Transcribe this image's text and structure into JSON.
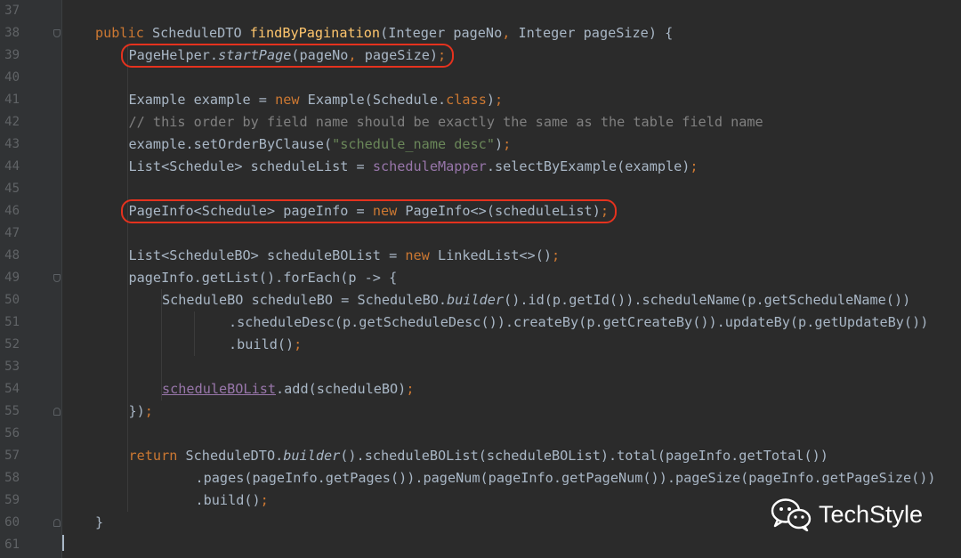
{
  "editor": {
    "lines": [
      {
        "no": "37",
        "tokens": []
      },
      {
        "no": "38",
        "fold": "start",
        "tokens": [
          {
            "t": "public ",
            "c": "k"
          },
          {
            "t": "ScheduleDTO "
          },
          {
            "t": "findByPagination",
            "c": "f"
          },
          {
            "t": "(Integer pageNo"
          },
          {
            "t": ", ",
            "c": "k"
          },
          {
            "t": "Integer pageSize) {"
          }
        ]
      },
      {
        "no": "39",
        "indent": 1,
        "tokens": [
          {
            "t": "PageHelper."
          },
          {
            "t": "startPage",
            "c": "i"
          },
          {
            "t": "(pageNo"
          },
          {
            "t": ", ",
            "c": "k"
          },
          {
            "t": "pageSize)"
          },
          {
            "t": ";",
            "c": "k"
          }
        ]
      },
      {
        "no": "40",
        "tokens": []
      },
      {
        "no": "41",
        "indent": 1,
        "tokens": [
          {
            "t": "Example example = "
          },
          {
            "t": "new ",
            "c": "k"
          },
          {
            "t": "Example(Schedule."
          },
          {
            "t": "class",
            "c": "k"
          },
          {
            "t": ")"
          },
          {
            "t": ";",
            "c": "k"
          }
        ]
      },
      {
        "no": "42",
        "indent": 1,
        "tokens": [
          {
            "t": "// this order by field name should be exactly the same as the table field name",
            "c": "c"
          }
        ]
      },
      {
        "no": "43",
        "indent": 1,
        "tokens": [
          {
            "t": "example.setOrderByClause("
          },
          {
            "t": "\"schedule_name desc\"",
            "c": "s"
          },
          {
            "t": ")"
          },
          {
            "t": ";",
            "c": "k"
          }
        ]
      },
      {
        "no": "44",
        "indent": 1,
        "tokens": [
          {
            "t": "List<Schedule> scheduleList = "
          },
          {
            "t": "scheduleMapper",
            "c": "p"
          },
          {
            "t": ".selectByExample(example)"
          },
          {
            "t": ";",
            "c": "k"
          }
        ]
      },
      {
        "no": "45",
        "tokens": []
      },
      {
        "no": "46",
        "indent": 1,
        "tokens": [
          {
            "t": "PageInfo<Schedule> pageInfo = "
          },
          {
            "t": "new ",
            "c": "k"
          },
          {
            "t": "PageInfo<>(scheduleList)"
          },
          {
            "t": ";",
            "c": "k"
          }
        ]
      },
      {
        "no": "47",
        "tokens": []
      },
      {
        "no": "48",
        "indent": 1,
        "tokens": [
          {
            "t": "List<ScheduleBO> scheduleBOList = "
          },
          {
            "t": "new ",
            "c": "k"
          },
          {
            "t": "LinkedList<>()"
          },
          {
            "t": ";",
            "c": "k"
          }
        ]
      },
      {
        "no": "49",
        "indent": 1,
        "fold": "start",
        "tokens": [
          {
            "t": "pageInfo.getList().forEach(p -> {"
          }
        ]
      },
      {
        "no": "50",
        "indent": 2,
        "tokens": [
          {
            "t": "ScheduleBO scheduleBO = ScheduleBO."
          },
          {
            "t": "builder",
            "c": "i"
          },
          {
            "t": "().id(p.getId()).scheduleName(p.getScheduleName())"
          }
        ]
      },
      {
        "no": "51",
        "indent": 4,
        "tokens": [
          {
            "t": ".scheduleDesc(p.getScheduleDesc()).createBy(p.getCreateBy()).updateBy(p.getUpdateBy())"
          }
        ]
      },
      {
        "no": "52",
        "indent": 4,
        "tokens": [
          {
            "t": ".build()"
          },
          {
            "t": ";",
            "c": "k"
          }
        ]
      },
      {
        "no": "53",
        "tokens": []
      },
      {
        "no": "54",
        "indent": 2,
        "tokens": [
          {
            "t": "scheduleBOList",
            "c": "u"
          },
          {
            "t": ".add(scheduleBO)"
          },
          {
            "t": ";",
            "c": "k"
          }
        ]
      },
      {
        "no": "55",
        "indent": 1,
        "fold": "end",
        "tokens": [
          {
            "t": "})"
          },
          {
            "t": ";",
            "c": "k"
          }
        ]
      },
      {
        "no": "56",
        "tokens": []
      },
      {
        "no": "57",
        "indent": 1,
        "tokens": [
          {
            "t": "return ",
            "c": "k"
          },
          {
            "t": "ScheduleDTO."
          },
          {
            "t": "builder",
            "c": "i"
          },
          {
            "t": "().scheduleBOList(scheduleBOList).total(pageInfo.getTotal())"
          }
        ]
      },
      {
        "no": "58",
        "indent": 3,
        "tokens": [
          {
            "t": ".pages(pageInfo.getPages()).pageNum(pageInfo.getPageNum()).pageSize(pageInfo.getPageSize())"
          }
        ]
      },
      {
        "no": "59",
        "indent": 3,
        "tokens": [
          {
            "t": ".build()"
          },
          {
            "t": ";",
            "c": "k"
          }
        ]
      },
      {
        "no": "60",
        "fold": "end",
        "tokens": [
          {
            "t": "}"
          }
        ]
      },
      {
        "no": "61",
        "tokens": []
      }
    ]
  },
  "highlights": [
    {
      "line": "39"
    },
    {
      "line": "46"
    }
  ],
  "watermark": {
    "icon": "wechat-icon",
    "text": "TechStyle"
  },
  "colors": {
    "background": "#2b2b2b",
    "keyword": "#cc7832",
    "method_declaration": "#ffc66d",
    "string": "#6a8759",
    "comment": "#808080",
    "field": "#9876aa",
    "highlight_box": "#e5321e"
  }
}
